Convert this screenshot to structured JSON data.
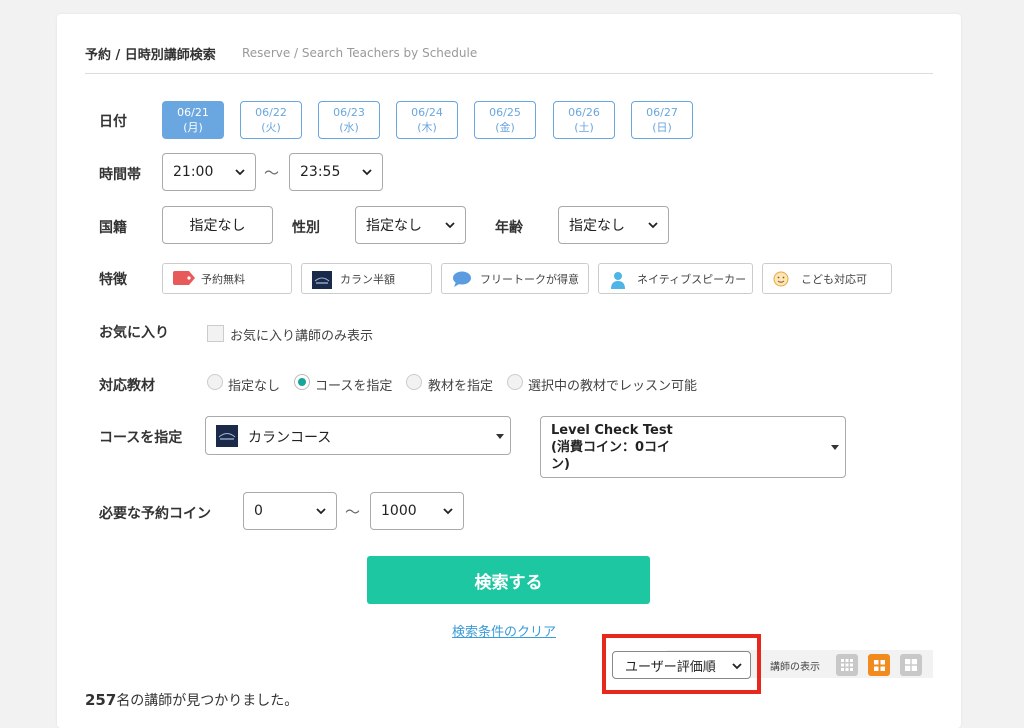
{
  "header": {
    "title": "予約 / 日時別講師検索",
    "subtitle": "Reserve / Search Teachers by Schedule"
  },
  "labels": {
    "date": "日付",
    "time": "時間帯",
    "nationality": "国籍",
    "gender": "性別",
    "age": "年齢",
    "features": "特徴",
    "favorite": "お気に入り",
    "material": "対応教材",
    "course": "コースを指定",
    "coins": "必要な予約コイン"
  },
  "dates": [
    {
      "date": "06/21",
      "day": "(月)",
      "active": true
    },
    {
      "date": "06/22",
      "day": "(火)",
      "active": false
    },
    {
      "date": "06/23",
      "day": "(水)",
      "active": false
    },
    {
      "date": "06/24",
      "day": "(木)",
      "active": false
    },
    {
      "date": "06/25",
      "day": "(金)",
      "active": false
    },
    {
      "date": "06/26",
      "day": "(土)",
      "active": false
    },
    {
      "date": "06/27",
      "day": "(日)",
      "active": false
    }
  ],
  "time": {
    "from": "21:00",
    "to": "23:55",
    "separator": "〜"
  },
  "nationality": {
    "value": "指定なし"
  },
  "gender": {
    "value": "指定なし"
  },
  "age": {
    "value": "指定なし"
  },
  "features": [
    {
      "label": "予約無料",
      "icon": "tag-icon"
    },
    {
      "label": "カラン半額",
      "icon": "callan-logo-icon"
    },
    {
      "label": "フリートークが得意",
      "icon": "speech-bubble-icon"
    },
    {
      "label": "ネイティブスピーカー",
      "icon": "person-icon"
    },
    {
      "label": "こども対応可",
      "icon": "smiley-icon"
    }
  ],
  "favorite": {
    "checkbox_label": "お気に入り講師のみ表示"
  },
  "material_options": [
    {
      "label": "指定なし",
      "checked": false
    },
    {
      "label": "コースを指定",
      "checked": true
    },
    {
      "label": "教材を指定",
      "checked": false
    },
    {
      "label": "選択中の教材でレッスン可能",
      "checked": false
    }
  ],
  "course": {
    "selected": "カランコース",
    "level_line1": "Level Check Test",
    "level_line2": "(消費コイン：0コイ",
    "level_line3": "ン)"
  },
  "coins": {
    "from": "0",
    "to": "1000",
    "separator": "〜"
  },
  "search_button": "検索する",
  "clear_link": "検索条件のクリア",
  "sort": {
    "value": "ユーザー評価順"
  },
  "view": {
    "label": "講師の表示"
  },
  "result": {
    "count": "257",
    "text": "名の講師が見つかりました。"
  },
  "colors": {
    "accent_blue": "#6aa6df",
    "search_green": "#1dc7a2",
    "active_orange": "#f28b1e",
    "highlight_red": "#e8281c"
  }
}
